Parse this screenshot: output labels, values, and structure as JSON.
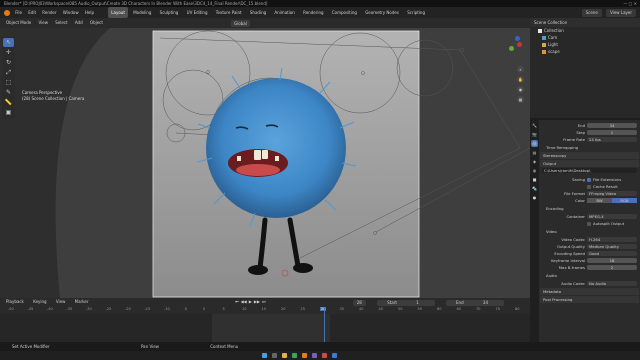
{
  "window": {
    "title": "Blender* [D:\\PROJ03\\Workspace\\085 Audio_Output\\Create 3D Characters In Blender With Ease\\3DC4_14_Final Render\\DC_15.blend]",
    "controls": "— ▢ ✕"
  },
  "menu": [
    "File",
    "Edit",
    "Render",
    "Window",
    "Help"
  ],
  "workspaces": [
    "Layout",
    "Modeling",
    "Sculpting",
    "UV Editing",
    "Texture Paint",
    "Shading",
    "Animation",
    "Rendering",
    "Compositing",
    "Geometry Nodes",
    "Scripting"
  ],
  "active_workspace": "Layout",
  "topright": {
    "scene": "Scene",
    "viewlayer": "View Layer"
  },
  "viewport_header": {
    "items": [
      "Object Mode",
      "View",
      "Select",
      "Add",
      "Object"
    ],
    "transform": "Global"
  },
  "camera_info": {
    "line1": "Camera Perspective",
    "line2": "(28) Scene Collection | Camera"
  },
  "outliner": {
    "title": "Scene Collection",
    "rows": [
      {
        "label": "Collection",
        "color": "#e8e8e8"
      },
      {
        "label": "Cam",
        "color": "#4ca0d0"
      },
      {
        "label": "Light",
        "color": "#d4a94a"
      },
      {
        "label": "scape",
        "color": "#e28f3a"
      }
    ]
  },
  "properties": {
    "rows_top": [
      {
        "label": "End",
        "value": "34"
      },
      {
        "label": "Step",
        "value": "1"
      },
      {
        "label": "Frame Rate",
        "value": "24 fps",
        "dropdown": true
      }
    ],
    "time_remap": "Time Remapping",
    "stereoscopy": "Stereoscopy",
    "output": "Output",
    "path": "C:\\Users\\ramih\\Desktop\\",
    "saving_label": "Saving",
    "file_ext": "File Extensions",
    "cache_result": "Cache Result",
    "file_format_label": "File Format",
    "file_format": "FFmpeg Video",
    "color_label": "Color",
    "color_opts": [
      "BW",
      "RGB"
    ],
    "color_active": "RGB",
    "encoding": "Encoding",
    "container_label": "Container",
    "container": "MPEG-4",
    "autosplit": "Autosplit Output",
    "video": "Video",
    "video_rows": [
      {
        "label": "Video Codec",
        "value": "H.264"
      },
      {
        "label": "Output Quality",
        "value": "Medium Quality"
      },
      {
        "label": "Encoding Speed",
        "value": "Good"
      },
      {
        "label": "Keyframe Interval",
        "value": "18",
        "plain": true
      },
      {
        "label": "Max B-frames",
        "value": "2",
        "plain": true
      }
    ],
    "audio": "Audio",
    "audio_codec_label": "Audio Codec",
    "audio_codec": "No Audio",
    "metadata": "Metadata",
    "postproc": "Post Processing"
  },
  "timeline": {
    "menus": [
      "Playback",
      "Keying",
      "View",
      "Marker"
    ],
    "current": "28",
    "start_label": "Start",
    "start": "1",
    "end_label": "End",
    "end": "34",
    "ticks": [
      "-50",
      "-45",
      "-40",
      "-35",
      "-30",
      "-25",
      "-20",
      "-15",
      "-10",
      "-5",
      "0",
      "5",
      "10",
      "15",
      "20",
      "25",
      "28",
      "35",
      "40",
      "45",
      "50",
      "55",
      "60",
      "65",
      "70",
      "75",
      "80"
    ]
  },
  "statusbar": [
    "Set Active Modifier",
    "Pan View",
    "Context Menu"
  ],
  "colors": {
    "accent": "#4772b3",
    "fur": "#3d86c6",
    "playhead": "#4772b3"
  },
  "icons": [
    "cursor-icon",
    "move-icon",
    "rotate-icon",
    "scale-icon",
    "transform-icon",
    "annotate-icon",
    "measure-icon",
    "add-cube-icon",
    "camera-icon",
    "hand-icon",
    "zoom-icon",
    "grid-icon"
  ]
}
